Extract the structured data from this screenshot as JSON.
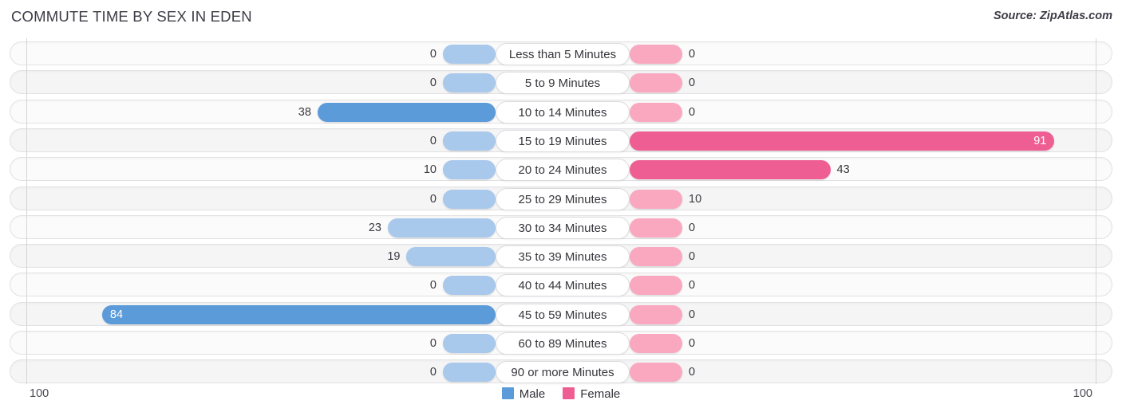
{
  "header": {
    "title": "COMMUTE TIME BY SEX IN EDEN",
    "source": "Source: ZipAtlas.com"
  },
  "axis": {
    "left_tick": "100",
    "right_tick": "100",
    "max": 100
  },
  "legend": {
    "items": [
      {
        "label": "Male",
        "color": "#5b9bd9"
      },
      {
        "label": "Female",
        "color": "#ef5e92"
      }
    ]
  },
  "colors": {
    "male_light": "#a8c8ec",
    "male_strong": "#5b9bd9",
    "female_light": "#f9a8c0",
    "female_strong": "#ef5e92",
    "row_bg": "#fbfbfb",
    "row_bg_alt": "#f5f5f6"
  },
  "chart_data": {
    "type": "bar",
    "title": "COMMUTE TIME BY SEX IN EDEN",
    "subtitle": "Source: ZipAtlas.com",
    "orientation": "horizontal-diverging",
    "xlabel": "",
    "ylabel": "",
    "xlim": [
      100,
      100
    ],
    "grid": false,
    "legend_position": "bottom-center",
    "categories": [
      "Less than 5 Minutes",
      "5 to 9 Minutes",
      "10 to 14 Minutes",
      "15 to 19 Minutes",
      "20 to 24 Minutes",
      "25 to 29 Minutes",
      "30 to 34 Minutes",
      "35 to 39 Minutes",
      "40 to 44 Minutes",
      "45 to 59 Minutes",
      "60 to 89 Minutes",
      "90 or more Minutes"
    ],
    "series": [
      {
        "name": "Male",
        "values": [
          0,
          0,
          38,
          0,
          10,
          0,
          23,
          19,
          0,
          84,
          0,
          0
        ]
      },
      {
        "name": "Female",
        "values": [
          0,
          0,
          0,
          91,
          43,
          10,
          0,
          0,
          0,
          0,
          0,
          0
        ]
      }
    ]
  },
  "rows": [
    {
      "category": "Less than 5 Minutes",
      "male": "0",
      "female": "0",
      "male_value": 0,
      "female_value": 0
    },
    {
      "category": "5 to 9 Minutes",
      "male": "0",
      "female": "0",
      "male_value": 0,
      "female_value": 0
    },
    {
      "category": "10 to 14 Minutes",
      "male": "38",
      "female": "0",
      "male_value": 38,
      "female_value": 0
    },
    {
      "category": "15 to 19 Minutes",
      "male": "0",
      "female": "91",
      "male_value": 0,
      "female_value": 91
    },
    {
      "category": "20 to 24 Minutes",
      "male": "10",
      "female": "43",
      "male_value": 10,
      "female_value": 43
    },
    {
      "category": "25 to 29 Minutes",
      "male": "0",
      "female": "10",
      "male_value": 0,
      "female_value": 10
    },
    {
      "category": "30 to 34 Minutes",
      "male": "23",
      "female": "0",
      "male_value": 23,
      "female_value": 0
    },
    {
      "category": "35 to 39 Minutes",
      "male": "19",
      "female": "0",
      "male_value": 19,
      "female_value": 0
    },
    {
      "category": "40 to 44 Minutes",
      "male": "0",
      "female": "0",
      "male_value": 0,
      "female_value": 0
    },
    {
      "category": "45 to 59 Minutes",
      "male": "84",
      "female": "0",
      "male_value": 84,
      "female_value": 0
    },
    {
      "category": "60 to 89 Minutes",
      "male": "0",
      "female": "0",
      "male_value": 0,
      "female_value": 0
    },
    {
      "category": "90 or more Minutes",
      "male": "0",
      "female": "0",
      "male_value": 0,
      "female_value": 0
    }
  ]
}
